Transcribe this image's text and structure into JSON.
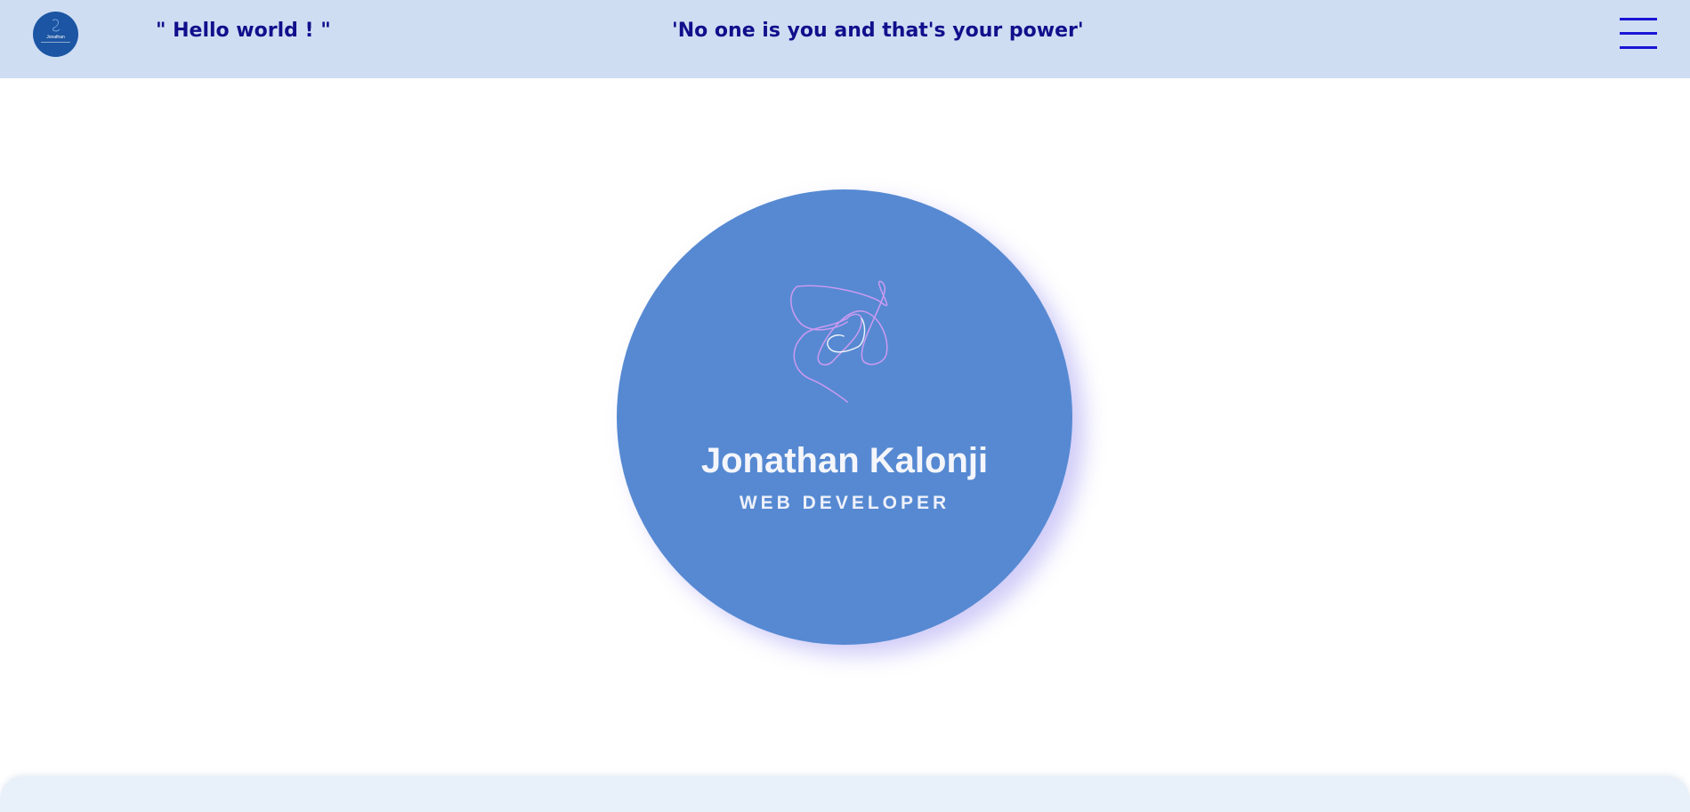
{
  "header": {
    "logo_icon": "monogram-logo",
    "logo_text": "Jonathan",
    "greeting": "\" Hello world ! \"",
    "motto": "'No one is you and that's your power'",
    "menu_icon": "hamburger-menu-icon"
  },
  "hero": {
    "signature_icon": "signature-scribble",
    "name": "Jonathan Kalonji",
    "role": "WEB DEVELOPER"
  },
  "colors": {
    "header_bg": "#cfddf3",
    "header_text": "#120f8c",
    "menu_icon": "#1a14d4",
    "hero_circle": "#5689d2",
    "signature_stroke": "#c89af0",
    "bottom_panel": "#e8f0fa"
  }
}
